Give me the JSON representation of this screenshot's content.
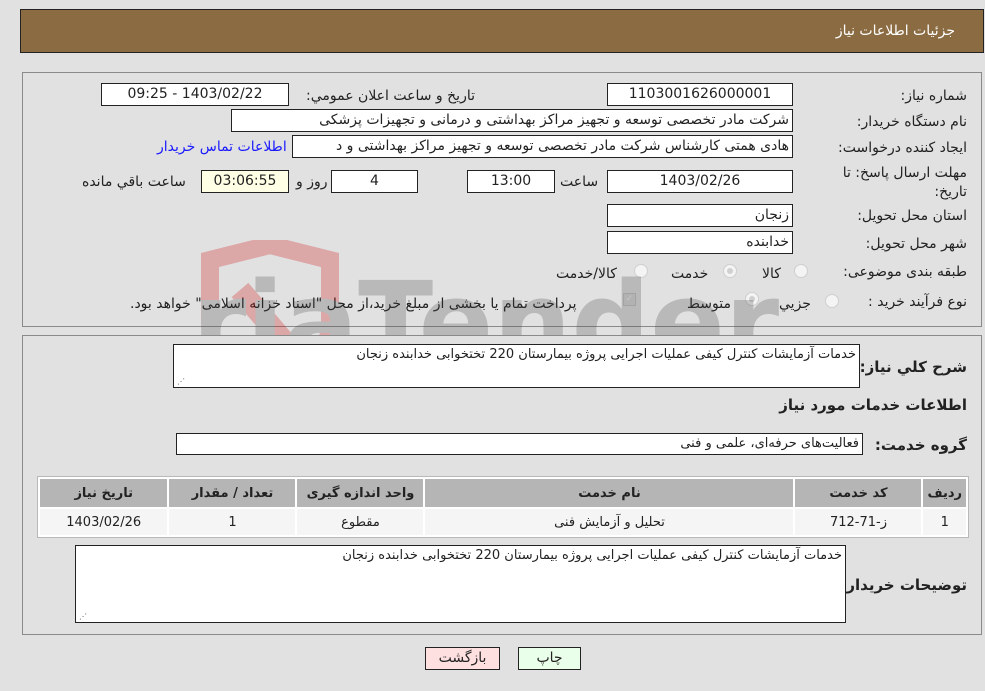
{
  "header": {
    "title": "جزئیات اطلاعات نیاز"
  },
  "info": {
    "need_number_label": "شماره نیاز:",
    "need_number": "1103001626000001",
    "announce_label": "تاریخ و ساعت اعلان عمومي:",
    "announce_value": "1403/02/22 - 09:25",
    "buyer_org_label": "نام دستگاه خريدار:",
    "buyer_org": "شرکت مادر تخصصی توسعه و تجهيز مراکز بهداشتی و درمانی و تجهيزات پزشکی",
    "creator_label": "ايجاد کننده درخواست:",
    "creator": "هادی همتی کارشناس شرکت مادر تخصصی توسعه و تجهيز مراکز بهداشتی و د",
    "contact_link": "اطلاعات تماس خريدار",
    "deadline_label": "مهلت ارسال پاسخ: تا تاریخ:",
    "deadline_date": "1403/02/26",
    "time_label": "ساعت",
    "deadline_time": "13:00",
    "days_value": "4",
    "days_label": "روز و",
    "remaining_time": "03:06:55",
    "remaining_label": "ساعت باقي مانده",
    "province_label": "استان محل تحويل:",
    "province": "زنجان",
    "city_label": "شهر محل تحويل:",
    "city": "خدابنده",
    "category_label": "طبقه بندی موضوعی:",
    "category_options": [
      {
        "label": "کالا",
        "selected": false
      },
      {
        "label": "خدمت",
        "selected": true
      },
      {
        "label": "کالا/خدمت",
        "selected": false
      }
    ],
    "process_label": "نوع فرآيند خريد :",
    "process_options": [
      {
        "label": "جزيي",
        "selected": false
      },
      {
        "label": "متوسط",
        "selected": true
      }
    ],
    "treasury_note": "پرداخت تمام يا بخشی از مبلغ خريد،از محل \"اسناد خزانه اسلامی\" خواهد بود.",
    "treasury_checked": true
  },
  "description": {
    "label": "شرح کلي نياز:",
    "value": "خدمات آزمایشات کنترل کیفی عملیات اجرایی پروژه بیمارستان 220 تختخوابی خدابنده زنجان"
  },
  "services": {
    "section_title": "اطلاعات خدمات مورد نياز",
    "group_label": "گروه خدمت:",
    "group_value": "فعاليت‌های حرفه‌ای، علمی و فنی",
    "table": {
      "headers": [
        "رديف",
        "کد خدمت",
        "نام خدمت",
        "واحد اندازه گيری",
        "تعداد / مقدار",
        "تاريخ نياز"
      ],
      "rows": [
        [
          "1",
          "ز-71-712",
          "تحليل و آزمايش فنی",
          "مقطوع",
          "1",
          "1403/02/26"
        ]
      ]
    }
  },
  "buyer_notes": {
    "label": "توضيحات خريدار:",
    "value": "خدمات آزمایشات کنترل کیفی عملیات اجرایی پروژه بیمارستان 220 تختخوابی خدابنده زنجان"
  },
  "buttons": {
    "print": "چاپ",
    "back": "بازگشت"
  },
  "colors": {
    "header_bg": "#8b6b42",
    "print_bg": "#eaffea",
    "back_bg": "#ffe0e0",
    "link": "#1a1aff"
  },
  "watermark": {
    "text": "AriaTender.neT"
  }
}
